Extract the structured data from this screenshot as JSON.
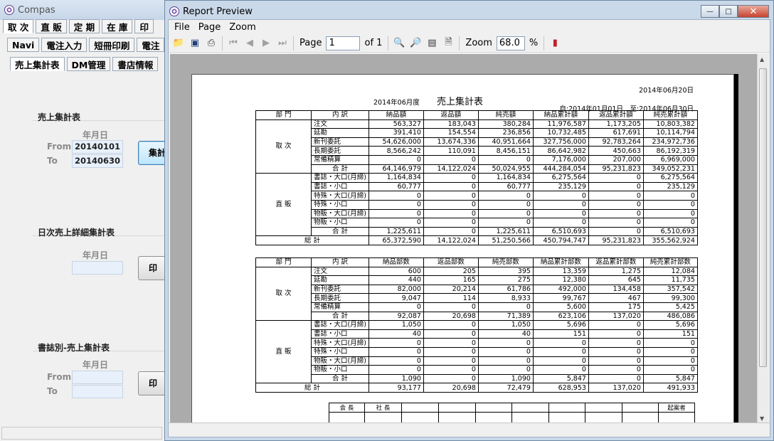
{
  "compas": {
    "title": "Compas",
    "tabs_row1": [
      "取 次",
      "直 販",
      "定 期",
      "在 庫",
      "印"
    ],
    "tabs_row2": [
      "Navi",
      "電注入力",
      "短冊印刷",
      "電注"
    ],
    "tabs_row3": [
      "売上集計表",
      "DM管理",
      "書店情報"
    ],
    "section_sales": {
      "title": "売上集計表",
      "column_header": "年月日",
      "from_label": "From",
      "to_label": "To",
      "from_value": "20140101",
      "to_value": "20140630",
      "button_label": "集計"
    },
    "section_daily": {
      "title": "日次売上詳細集計表",
      "column_header": "年月日",
      "button_label": "印"
    },
    "section_magazine": {
      "title": "書誌別-売上集計表",
      "column_header": "年月日",
      "from_label": "From",
      "to_label": "To",
      "button_label": "印"
    }
  },
  "preview": {
    "title": "Report Preview",
    "menu": [
      "File",
      "Page",
      "Zoom"
    ],
    "toolbar": {
      "page_label": "Page",
      "page_value": "1",
      "of_label": "of 1",
      "zoom_label": "Zoom",
      "zoom_value": "68.0",
      "percent_label": "%"
    },
    "icons": [
      "open-folder-icon",
      "save-icon",
      "print-icon",
      "first-page-icon",
      "prev-page-icon",
      "next-page-icon",
      "last-page-icon",
      "zoom-in-icon",
      "zoom-out-icon",
      "page-width-icon",
      "whole-page-icon",
      "close-preview-icon"
    ]
  },
  "report": {
    "print_date": "2014年06月20日",
    "period_title": "2014年06月度",
    "title": "売上集計表",
    "range": "自:2014年01月01日　至:2014年06月30日",
    "amount_headers": [
      "部 門",
      "内 訳",
      "納品額",
      "返品額",
      "純売額",
      "納品累計額",
      "返品累計額",
      "純売累計額"
    ],
    "amount_rows": [
      [
        "取 次",
        "注文",
        "563,327",
        "183,043",
        "380,284",
        "11,976,587",
        "1,173,205",
        "10,803,382"
      ],
      [
        "",
        "延勘",
        "391,410",
        "154,554",
        "236,856",
        "10,732,485",
        "617,691",
        "10,114,794"
      ],
      [
        "",
        "新刊委託",
        "54,626,000",
        "13,674,336",
        "40,951,664",
        "327,756,000",
        "92,783,264",
        "234,972,736"
      ],
      [
        "",
        "長期委託",
        "8,566,242",
        "110,091",
        "8,456,151",
        "86,642,982",
        "450,663",
        "86,192,319"
      ],
      [
        "",
        "常備精算",
        "0",
        "0",
        "0",
        "7,176,000",
        "207,000",
        "6,969,000"
      ],
      [
        "",
        "合 計",
        "64,146,979",
        "14,122,024",
        "50,024,955",
        "444,284,054",
        "95,231,823",
        "349,052,231"
      ],
      [
        "直 販",
        "書誌・大口(月締)",
        "1,164,834",
        "0",
        "1,164,834",
        "6,275,564",
        "0",
        "6,275,564"
      ],
      [
        "",
        "書誌・小口",
        "60,777",
        "0",
        "60,777",
        "235,129",
        "0",
        "235,129"
      ],
      [
        "",
        "特殊・大口(月締)",
        "0",
        "0",
        "0",
        "0",
        "0",
        "0"
      ],
      [
        "",
        "特殊・小口",
        "0",
        "0",
        "0",
        "0",
        "0",
        "0"
      ],
      [
        "",
        "物販・大口(月締)",
        "0",
        "0",
        "0",
        "0",
        "0",
        "0"
      ],
      [
        "",
        "物販・小口",
        "0",
        "0",
        "0",
        "0",
        "0",
        "0"
      ],
      [
        "",
        "合 計",
        "1,225,611",
        "0",
        "1,225,611",
        "6,510,693",
        "0",
        "6,510,693"
      ],
      [
        "総 計",
        "",
        "65,372,590",
        "14,122,024",
        "51,250,566",
        "450,794,747",
        "95,231,823",
        "355,562,924"
      ]
    ],
    "count_headers": [
      "部 門",
      "内 訳",
      "納品部数",
      "返品部数",
      "純売部数",
      "納品累計部数",
      "返品累計部数",
      "純売累計部数"
    ],
    "count_rows": [
      [
        "取 次",
        "注文",
        "600",
        "205",
        "395",
        "13,359",
        "1,275",
        "12,084"
      ],
      [
        "",
        "延勘",
        "440",
        "165",
        "275",
        "12,380",
        "645",
        "11,735"
      ],
      [
        "",
        "新刊委託",
        "82,000",
        "20,214",
        "61,786",
        "492,000",
        "134,458",
        "357,542"
      ],
      [
        "",
        "長期委託",
        "9,047",
        "114",
        "8,933",
        "99,767",
        "467",
        "99,300"
      ],
      [
        "",
        "常備精算",
        "0",
        "0",
        "0",
        "5,600",
        "175",
        "5,425"
      ],
      [
        "",
        "合 計",
        "92,087",
        "20,698",
        "71,389",
        "623,106",
        "137,020",
        "486,086"
      ],
      [
        "直 販",
        "書誌・大口(月締)",
        "1,050",
        "0",
        "1,050",
        "5,696",
        "0",
        "5,696"
      ],
      [
        "",
        "書誌・小口",
        "40",
        "0",
        "40",
        "151",
        "0",
        "151"
      ],
      [
        "",
        "特殊・大口(月締)",
        "0",
        "0",
        "0",
        "0",
        "0",
        "0"
      ],
      [
        "",
        "特殊・小口",
        "0",
        "0",
        "0",
        "0",
        "0",
        "0"
      ],
      [
        "",
        "物販・大口(月締)",
        "0",
        "0",
        "0",
        "0",
        "0",
        "0"
      ],
      [
        "",
        "物販・小口",
        "0",
        "0",
        "0",
        "0",
        "0",
        "0"
      ],
      [
        "",
        "合 計",
        "1,090",
        "0",
        "1,090",
        "5,847",
        "0",
        "5,847"
      ],
      [
        "総 計",
        "",
        "93,177",
        "20,698",
        "72,479",
        "628,953",
        "137,020",
        "491,933"
      ]
    ],
    "sign_headers": [
      "会 長",
      "社 長",
      "",
      "",
      "",
      "",
      "",
      "",
      "",
      "起案者"
    ]
  }
}
